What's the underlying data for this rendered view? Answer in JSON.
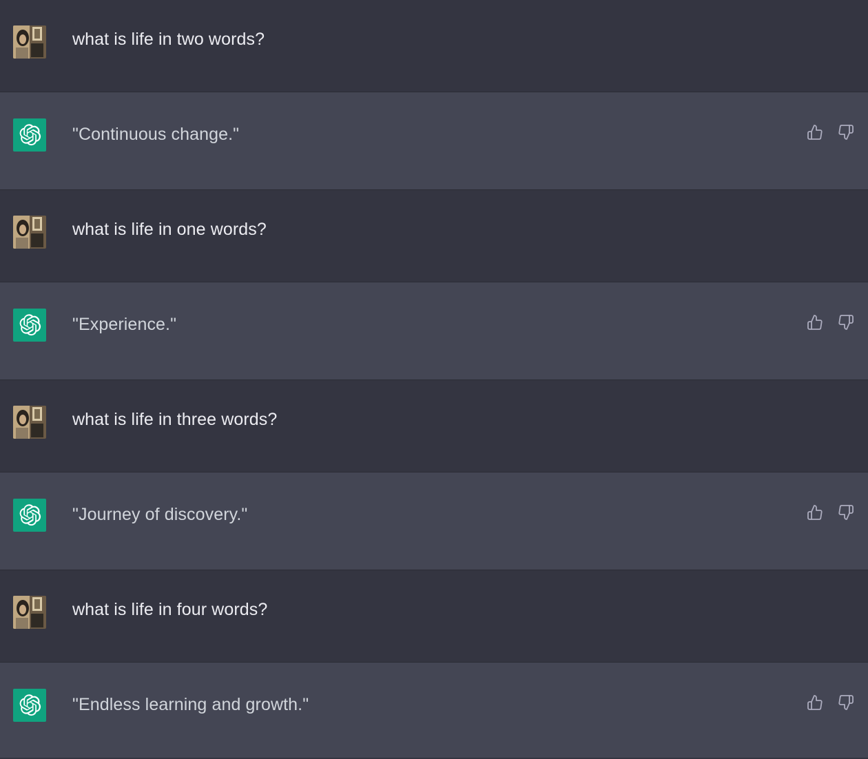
{
  "messages": [
    {
      "role": "user",
      "text": "what is life in two words?"
    },
    {
      "role": "assistant",
      "text": "\"Continuous change.\""
    },
    {
      "role": "user",
      "text": "what is life in one words?"
    },
    {
      "role": "assistant",
      "text": "\"Experience.\""
    },
    {
      "role": "user",
      "text": "what is life in three words?"
    },
    {
      "role": "assistant",
      "text": "\"Journey of discovery.\""
    },
    {
      "role": "user",
      "text": "what is life in four words?"
    },
    {
      "role": "assistant",
      "text": "\"Endless learning and growth.\""
    }
  ],
  "icons": {
    "user_avatar": "user-photo-avatar",
    "bot_avatar": "openai-logo-icon",
    "like": "thumbs-up-icon",
    "dislike": "thumbs-down-icon"
  },
  "colors": {
    "user_bg": "#343541",
    "assistant_bg": "#444654",
    "bot_avatar_bg": "#10a37f",
    "text": "#ececf1",
    "icon": "#acacbe"
  }
}
